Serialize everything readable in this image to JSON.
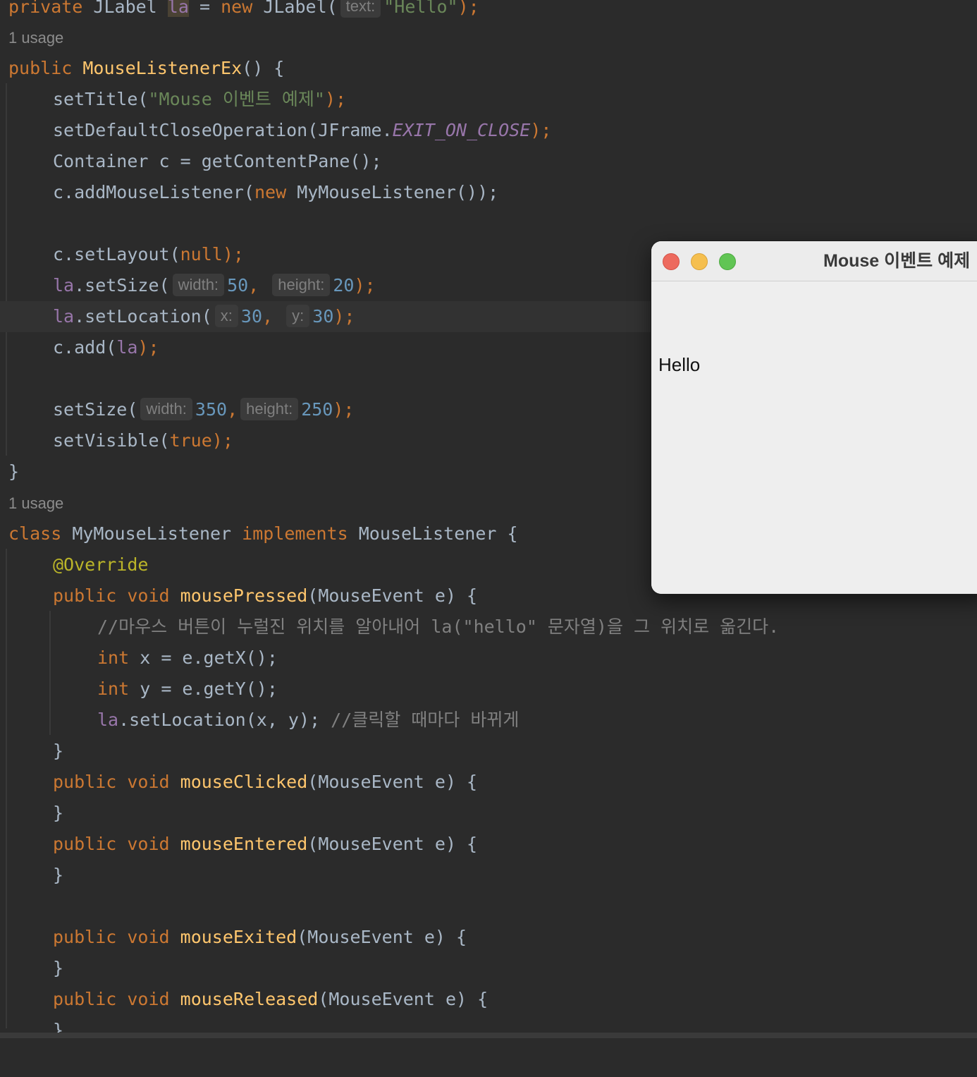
{
  "editor": {
    "usage_label": "1 usage",
    "line_field": {
      "private_kw": "private",
      "type": "JLabel",
      "name": "la",
      "eq": "=",
      "new_kw": "new",
      "ctor": "JLabel(",
      "hint_text": "text:",
      "str": "\"Hello\"",
      "end": ");"
    },
    "line_ctor": {
      "public_kw": "public",
      "name": "MouseListenerEx",
      "rest": "() {"
    },
    "line_settitle": {
      "fn": "setTitle(",
      "str": "\"Mouse 이벤트 예제\"",
      "end": ");"
    },
    "line_close": {
      "fn": "setDefaultCloseOperation(JFrame.",
      "const": "EXIT_ON_CLOSE",
      "end": ");"
    },
    "line_container": {
      "code": "Container c = getContentPane();"
    },
    "line_addlistener": {
      "pre": "c.addMouseListener(",
      "new_kw": "new",
      "rest": "MyMouseListener());"
    },
    "line_setlayout": {
      "pre": "c.setLayout(",
      "null_kw": "null",
      "end": ");"
    },
    "line_lasetsize": {
      "field": "la",
      "fn": ".setSize(",
      "hint_w": "width:",
      "w": "50",
      "comma": ",",
      "hint_h": "height:",
      "h": "20",
      "end": ");"
    },
    "line_lasetlocation": {
      "field": "la",
      "fn": ".setLocation(",
      "hint_x": "x:",
      "x": "30",
      "comma": ",",
      "hint_y": "y:",
      "y": "30",
      "end": ");"
    },
    "line_cadd": {
      "pre": "c.add(",
      "field": "la",
      "end": ");"
    },
    "line_setsize": {
      "fn": "setSize(",
      "hint_w": "width:",
      "w": "350",
      "comma": ",",
      "hint_h": "height:",
      "h": "250",
      "end": ");"
    },
    "line_setvisible": {
      "fn": "setVisible(",
      "true_kw": "true",
      "end": ");"
    },
    "brace_close": "}",
    "line_class": {
      "class_kw": "class",
      "name": "MyMouseListener",
      "impl_kw": "implements",
      "iface": "MouseListener {"
    },
    "line_override": {
      "ann": "@Override"
    },
    "method_pressed": {
      "public_kw": "public",
      "void_kw": "void",
      "name": "mousePressed",
      "params": "(MouseEvent e) {"
    },
    "line_comment": {
      "text": "//마우스 버튼이 누럴진 위치를 알아내어 la(\"hello\" 문자열)을 그 위치로 옮긴다."
    },
    "line_intx": {
      "int_kw": "int",
      "code": "x = e.getX();"
    },
    "line_inty": {
      "int_kw": "int",
      "code": "y = e.getY();"
    },
    "line_lasetlocxy": {
      "field": "la",
      "code": ".setLocation(x, y);",
      "comment": "//클릭할 때마다 바뀌게"
    },
    "method_clicked": {
      "public_kw": "public",
      "void_kw": "void",
      "name": "mouseClicked",
      "params": "(MouseEvent e) {"
    },
    "method_entered": {
      "public_kw": "public",
      "void_kw": "void",
      "name": "mouseEntered",
      "params": "(MouseEvent e) {"
    },
    "method_exited": {
      "public_kw": "public",
      "void_kw": "void",
      "name": "mouseExited",
      "params": "(MouseEvent e) {"
    },
    "method_released": {
      "public_kw": "public",
      "void_kw": "void",
      "name": "mouseReleased",
      "params": "(MouseEvent e) {"
    }
  },
  "window": {
    "title": "Mouse 이벤트 예제",
    "label_text": "Hello"
  },
  "colors": {
    "editor_bg": "#2b2b2b",
    "keyword": "#cc7832",
    "method": "#ffc66d",
    "string": "#6a8759",
    "number": "#6897bb",
    "field": "#9876aa",
    "annotation": "#bbb529",
    "comment": "#808080",
    "window_bg": "#eeeeee",
    "close_button": "#ed6a5e",
    "minimize_button": "#f5bf4f",
    "maximize_button": "#61c554"
  }
}
